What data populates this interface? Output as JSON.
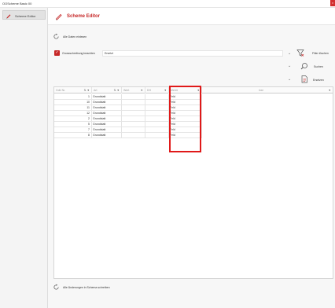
{
  "window": {
    "title": "OOScheme Basic 00",
    "close": "×"
  },
  "sidebar": {
    "items": [
      {
        "label": "Scheme Editor",
        "icon": "pencil-icon"
      }
    ]
  },
  "header": {
    "title": "Scheme Editor",
    "icon": "pencil-icon"
  },
  "actions": {
    "read_all": "Alle Daten einlesen",
    "case_sensitive_label": "Grossschreibung beachten",
    "case_sensitive_value": "Ersetzt",
    "case_sensitive_checked": true,
    "filter_label": "Filter löschen",
    "search_label": "Suchen",
    "replace_label": "Ersetzen",
    "write_all": "Alle Änderungen in Schema schreiben"
  },
  "table": {
    "columns": [
      "Gdb Nr.",
      "Art",
      "Wert",
      "DH",
      "Metrit",
      "Inst"
    ],
    "rows": [
      {
        "gdb": "1",
        "art": "Grundstatt",
        "metrit": "Feld"
      },
      {
        "gdb": "10",
        "art": "Grundstatt",
        "metrit": "Feld"
      },
      {
        "gdb": "11",
        "art": "Grundstatt",
        "metrit": "Feld"
      },
      {
        "gdb": "12",
        "art": "Grundstatt",
        "metrit": "Feld"
      },
      {
        "gdb": "2",
        "art": "Grundstatt",
        "metrit": "Feld"
      },
      {
        "gdb": "5",
        "art": "Grundstatt",
        "metrit": "Feld"
      },
      {
        "gdb": "7",
        "art": "Grundstatt",
        "metrit": "Feld"
      },
      {
        "gdb": "8",
        "art": "Grundstatt",
        "metrit": "Feld"
      }
    ]
  },
  "colors": {
    "accent": "#c62828",
    "highlight": "#e01919"
  }
}
